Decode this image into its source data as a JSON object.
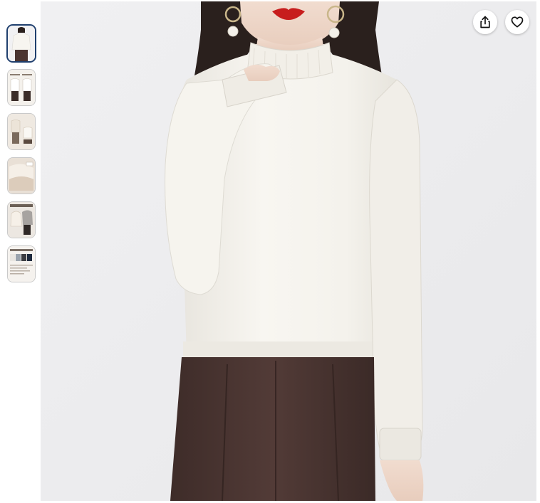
{
  "gallery": {
    "thumbnails": [
      {
        "label": "",
        "icon": "model-front-view",
        "selected": true
      },
      {
        "label": "",
        "icon": "model-pose-collage"
      },
      {
        "label": "",
        "icon": "styling-collage"
      },
      {
        "label": "",
        "icon": "fabric-detail"
      },
      {
        "label": "",
        "icon": "fleece-lining-detail"
      },
      {
        "label": "",
        "icon": "color-options-chart"
      }
    ],
    "selected_index": 0
  },
  "actions": {
    "share_icon": "share-icon",
    "wishlist_icon": "heart-icon"
  },
  "colors": {
    "accent_selected_border": "#1f3f6e",
    "image_background": "#eeeef0",
    "sweater": "#f3f1ec",
    "trousers": "#4a3431",
    "hair": "#2a201d",
    "lips": "#c71d1d"
  }
}
